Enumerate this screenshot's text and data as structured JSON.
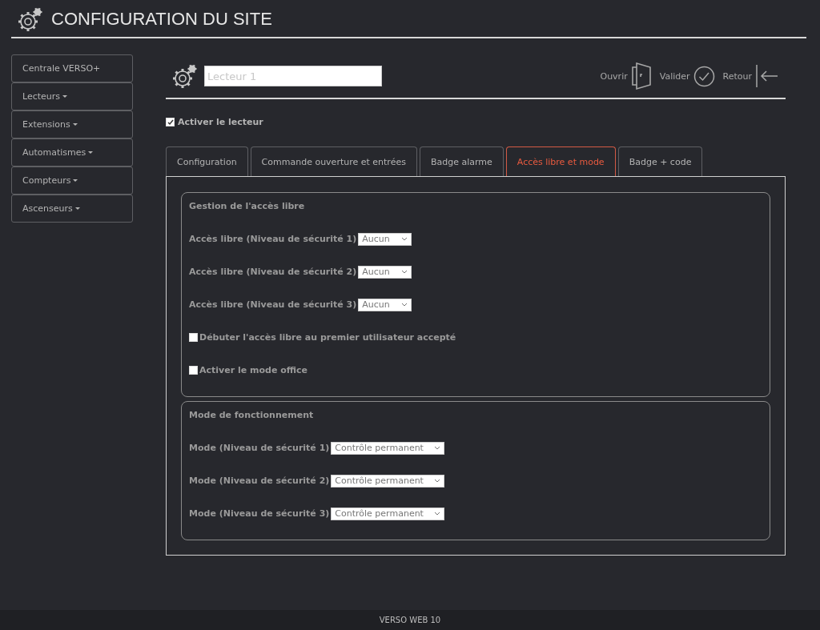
{
  "header": {
    "title": "CONFIGURATION DU SITE"
  },
  "sidebar": {
    "items": [
      {
        "label": "Centrale VERSO+",
        "dropdown": false
      },
      {
        "label": "Lecteurs",
        "dropdown": true
      },
      {
        "label": "Extensions",
        "dropdown": true
      },
      {
        "label": "Automatismes",
        "dropdown": true
      },
      {
        "label": "Compteurs",
        "dropdown": true
      },
      {
        "label": "Ascenseurs",
        "dropdown": true
      }
    ]
  },
  "toolbar": {
    "name_field": {
      "placeholder": "Lecteur 1"
    },
    "actions": [
      {
        "label": "Ouvrir",
        "kind": "open"
      },
      {
        "label": "Valider",
        "kind": "validate"
      },
      {
        "label": "Retour",
        "kind": "back"
      }
    ]
  },
  "enable_reader": {
    "label": "Activer le lecteur",
    "checked": true
  },
  "tabs": [
    {
      "label": "Configuration",
      "selected": false
    },
    {
      "label": "Commande ouverture et entrées",
      "selected": false
    },
    {
      "label": "Badge alarme",
      "selected": false
    },
    {
      "label": "Accès libre et mode",
      "selected": true
    },
    {
      "label": "Badge + code",
      "selected": false
    }
  ],
  "sections": [
    {
      "title": "Gestion de l'accès libre",
      "rows": [
        {
          "kind": "select",
          "label": "Accès libre (Niveau de sécurité 1)",
          "value": "Aucun"
        },
        {
          "kind": "select",
          "label": "Accès libre (Niveau de sécurité 2)",
          "value": "Aucun"
        },
        {
          "kind": "select",
          "label": "Accès libre (Niveau de sécurité 3)",
          "value": "Aucun"
        },
        {
          "kind": "checkbox",
          "label": "Débuter l'accès libre au premier utilisateur accepté",
          "checked": false
        },
        {
          "kind": "checkbox",
          "label": "Activer le mode office",
          "checked": false
        }
      ]
    },
    {
      "title": "Mode de fonctionnement",
      "rows": [
        {
          "kind": "select",
          "label": "Mode (Niveau de sécurité 1)",
          "value": "Contrôle permanent"
        },
        {
          "kind": "select",
          "label": "Mode (Niveau de sécurité 2)",
          "value": "Contrôle permanent"
        },
        {
          "kind": "select",
          "label": "Mode (Niveau de sécurité 3)",
          "value": "Contrôle permanent"
        }
      ]
    }
  ],
  "footer": {
    "text": "VERSO WEB 10"
  }
}
